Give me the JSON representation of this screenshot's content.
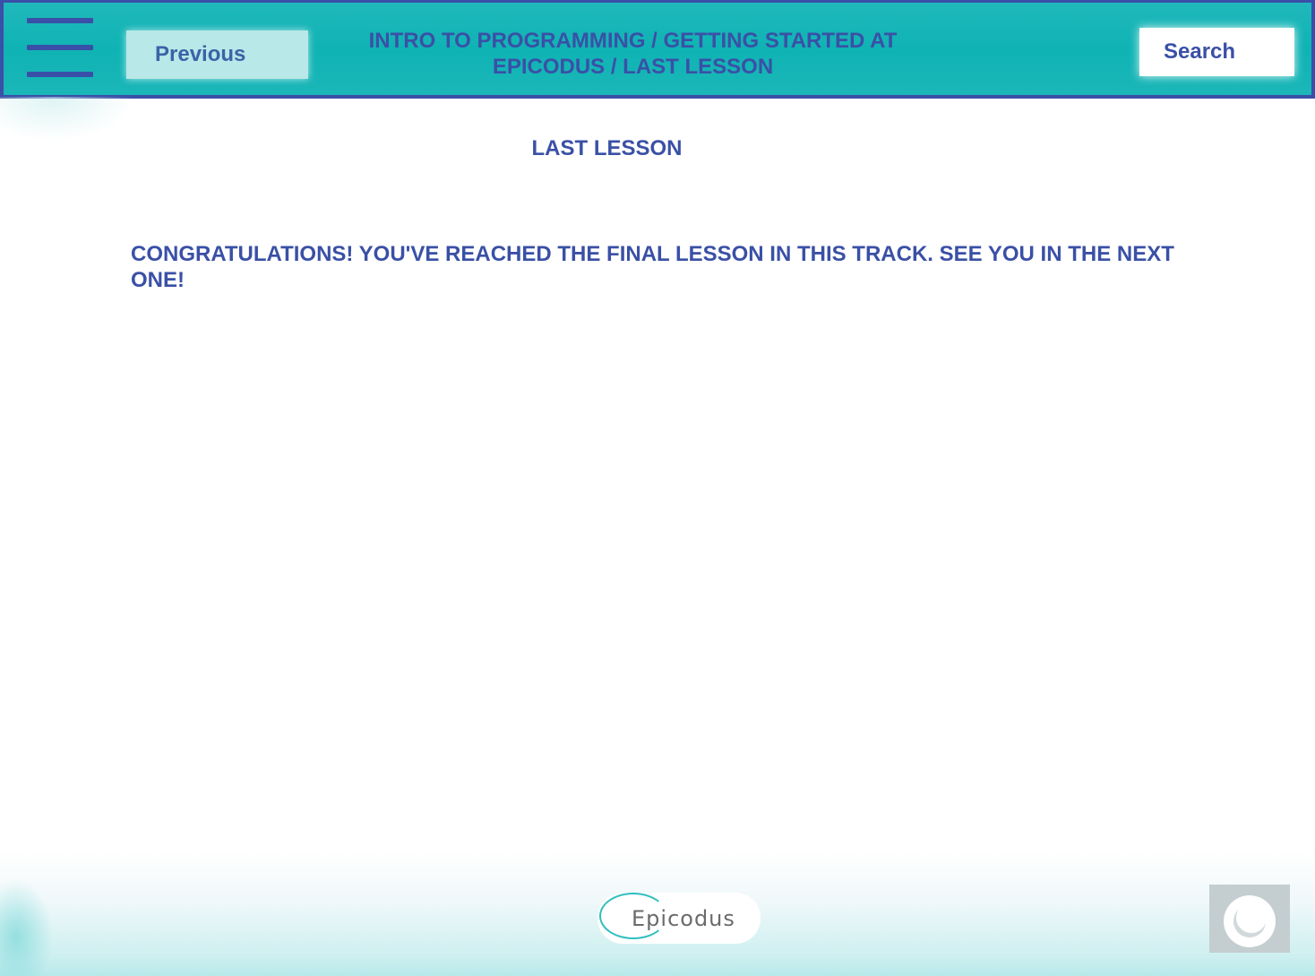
{
  "header": {
    "previous_label": "Previous",
    "breadcrumb_line1": "INTRO TO PROGRAMMING / GETTING STARTED AT",
    "breadcrumb_line2": "EPICODUS / LAST LESSON",
    "search_label": "Search"
  },
  "lesson": {
    "title": "LAST LESSON",
    "body": "CONGRATULATIONS! YOU'VE REACHED THE FINAL LESSON IN THIS TRACK. SEE YOU IN THE NEXT ONE!"
  },
  "footer": {
    "logo_text": "Epicodus"
  },
  "icons": {
    "menu": "hamburger-menu-icon",
    "chat": "chat-bubble-icon"
  },
  "colors": {
    "header_bg": "#0fb3b4",
    "header_border": "#3a4fa8",
    "text_primary": "#3a50a6",
    "previous_btn_bg": "#b8e8e7",
    "search_btn_bg": "#ffffff",
    "logo_ring": "#2fbfbf"
  }
}
